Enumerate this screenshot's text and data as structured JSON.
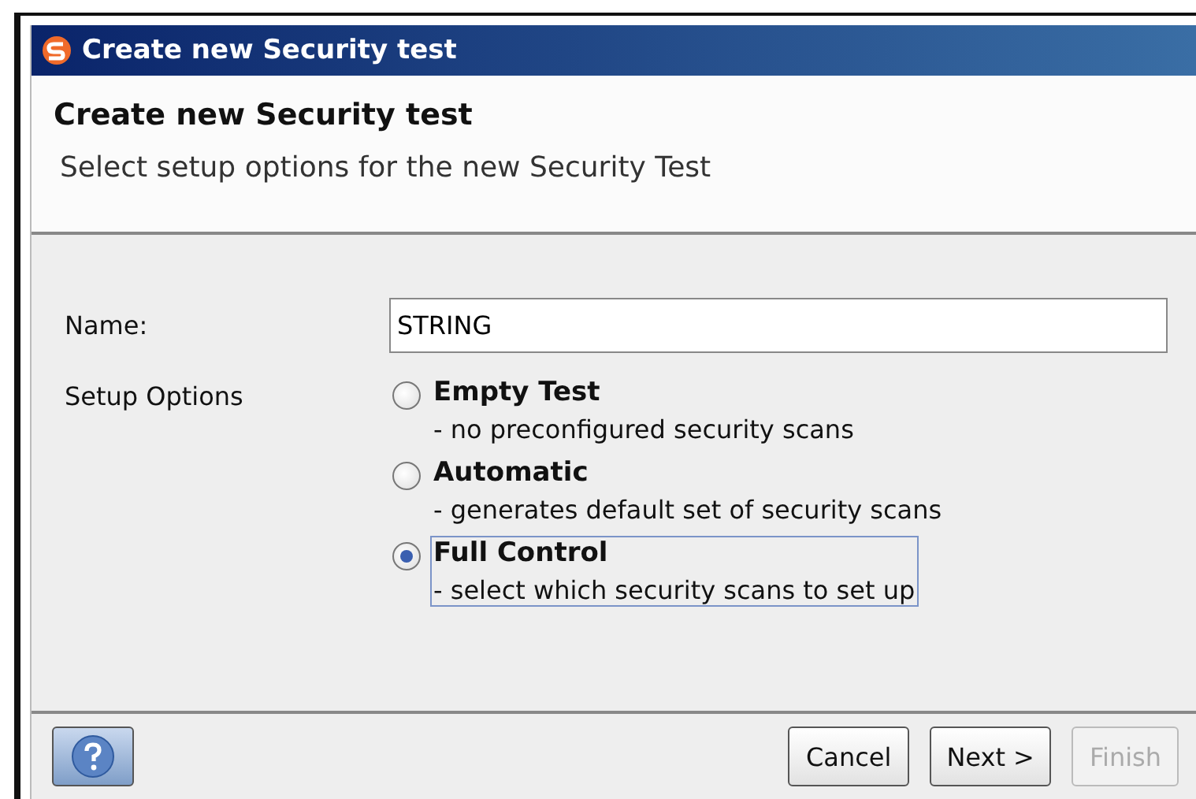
{
  "window": {
    "title": "Create new Security test"
  },
  "header": {
    "title": "Create new Security test",
    "subtitle": "Select setup options for the new Security Test"
  },
  "name_field": {
    "label": "Name:",
    "value": "STRING"
  },
  "setup": {
    "label": "Setup Options",
    "options": [
      {
        "label": "Empty Test",
        "description": "- no preconfigured security scans",
        "selected": false,
        "focused": false
      },
      {
        "label": "Automatic",
        "description": "- generates default set of security scans",
        "selected": false,
        "focused": false
      },
      {
        "label": "Full Control",
        "description": "- select which security scans to set up",
        "selected": true,
        "focused": true
      }
    ]
  },
  "buttons": [
    {
      "label": "Cancel",
      "disabled": false
    },
    {
      "label": "Next >",
      "disabled": false
    },
    {
      "label": "Finish",
      "disabled": true
    }
  ]
}
